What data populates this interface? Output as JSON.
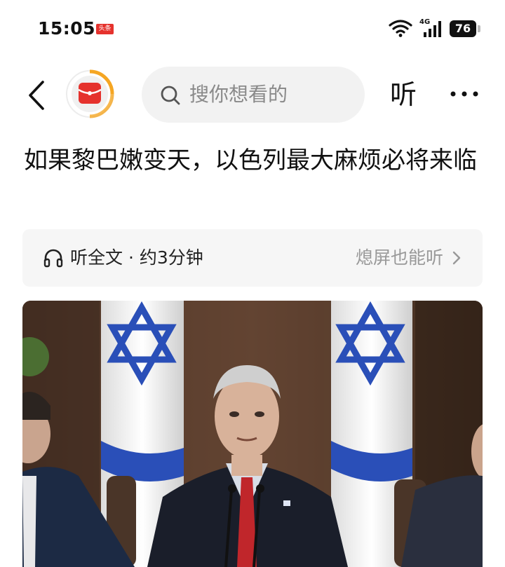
{
  "status_bar": {
    "time": "15:05",
    "app_badge": "头条",
    "network": "4G",
    "battery": "76"
  },
  "nav": {
    "search_placeholder": "搜你想看的",
    "listen_label": "听"
  },
  "article": {
    "title": "如果黎巴嫩变天，以色列最大麻烦必将来临"
  },
  "listen_bar": {
    "full_text_label": "听全文 · 约3分钟",
    "screen_off_label": "熄屏也能听"
  },
  "colors": {
    "accent_red": "#e5322d",
    "logo_orange": "#f5a623",
    "flag_blue": "#2a4fb8"
  }
}
